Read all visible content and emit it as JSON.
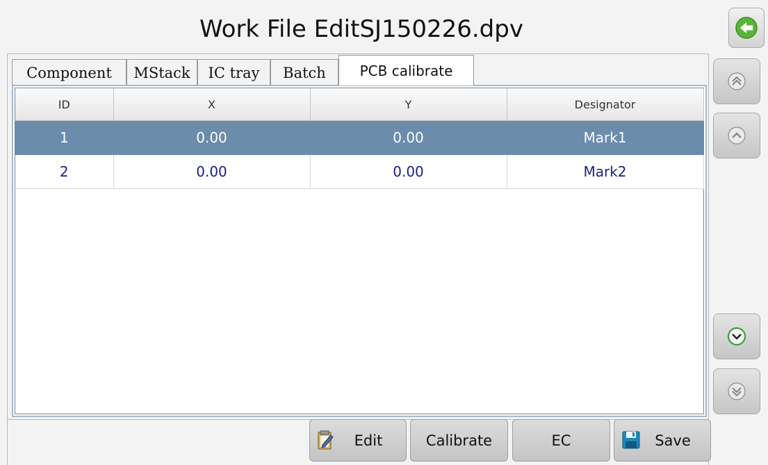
{
  "header": {
    "title": "Work File EditSJ150226.dpv"
  },
  "nav": {
    "back_icon": "back-arrow-icon",
    "side_buttons": [
      "page-up-double-icon",
      "scroll-up-icon",
      "scroll-down-icon",
      "page-down-double-icon"
    ]
  },
  "tabs": [
    {
      "label": "Component"
    },
    {
      "label": "MStack"
    },
    {
      "label": "IC tray"
    },
    {
      "label": "Batch"
    },
    {
      "label": "PCB calibrate",
      "active": true
    }
  ],
  "table": {
    "columns": [
      "ID",
      "X",
      "Y",
      "Designator"
    ],
    "rows": [
      {
        "id": "1",
        "x": "0.00",
        "y": "0.00",
        "designator": "Mark1",
        "selected": true
      },
      {
        "id": "2",
        "x": "0.00",
        "y": "0.00",
        "designator": "Mark2",
        "selected": false
      }
    ]
  },
  "toolbar": {
    "edit_label": "Edit",
    "calibrate_label": "Calibrate",
    "ec_label": "EC",
    "save_label": "Save"
  },
  "colors": {
    "selected_row": "#6b8cab",
    "row_text": "#1c1c8a",
    "back_icon": "#5ab436",
    "scroll_down_icon": "#3aa23a"
  }
}
